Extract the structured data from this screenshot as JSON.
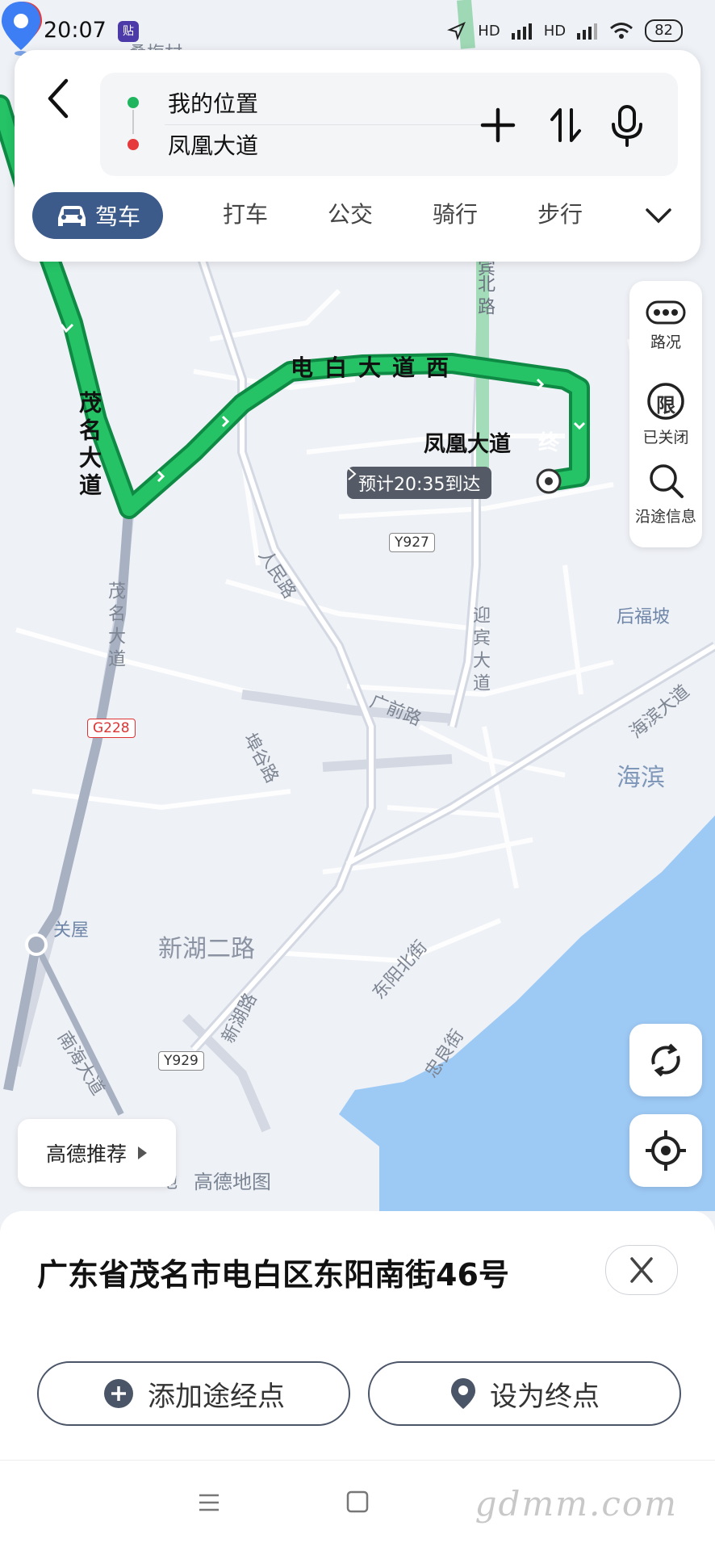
{
  "status": {
    "time": "20:07",
    "badge": "贴",
    "net1": "HD",
    "net2": "HD",
    "battery": "82"
  },
  "route": {
    "from": "我的位置",
    "to": "凤凰大道",
    "modes": [
      {
        "label": "驾车"
      },
      {
        "label": "打车"
      },
      {
        "label": "公交"
      },
      {
        "label": "骑行"
      },
      {
        "label": "步行"
      }
    ]
  },
  "side_panel": {
    "traffic": "路况",
    "restrict": "已关闭",
    "restrict_glyph": "限",
    "along": "沿途信息"
  },
  "map": {
    "labels": {
      "dest_name": "凤凰大道",
      "end_marker": "终",
      "eta": "预计20:35到达",
      "road1": "电白大道西",
      "road2": "茂名大道",
      "road3": "茂名大道",
      "road4": "人民路",
      "road5": "迎宾大道",
      "road6": "广前路",
      "road7": "埠谷路",
      "road8": "新湖二路",
      "road9": "新湖路",
      "road10": "东阳北街",
      "road11": "南海大道",
      "road12": "海滨大道",
      "road13": "北路",
      "road13b": "宾",
      "road14": "忠良街",
      "area1": "后福坡",
      "area2": "海滨",
      "area3": "关屋",
      "area4": "桑梅村",
      "shield1": "Y927",
      "shield2": "G228",
      "shield3": "Y929",
      "map_logo": "高德地图",
      "map_logo_prefix": "地"
    },
    "recommend": "高德推荐"
  },
  "place": {
    "address": "广东省茂名市电白区东阳南街46号",
    "add_waypoint": "添加途经点",
    "set_destination": "设为终点"
  },
  "watermark": "gdmm.com",
  "colors": {
    "route": "#1fae5c",
    "accent": "#3c5a8a",
    "start_dot": "#1fb55f",
    "end_dot": "#e5393b",
    "sea": "#9dc9f5",
    "pin": "#3d7ef5"
  }
}
